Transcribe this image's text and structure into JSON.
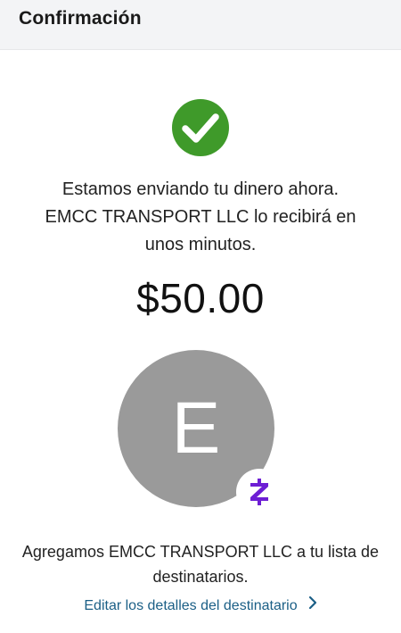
{
  "header": {
    "title": "Confirmación"
  },
  "status": {
    "icon": "check-circle-icon",
    "color": "#3f9a2a"
  },
  "message": {
    "line1": "Estamos enviando tu dinero ahora.",
    "line2": "EMCC TRANSPORT LLC lo recibirá en",
    "line3": "unos minutos."
  },
  "amount": "$50.00",
  "recipient": {
    "initial": "E",
    "avatar_color": "#9a9a9a",
    "badge_icon": "zelle-icon",
    "badge_color": "#6d1ed4"
  },
  "added_note": {
    "line1": "Agregamos EMCC TRANSPORT LLC a tu lista de",
    "line2": "destinatarios."
  },
  "edit_link": {
    "label": "Editar los detalles del destinatario",
    "icon": "chevron-right-icon",
    "color": "#1b5f86"
  }
}
